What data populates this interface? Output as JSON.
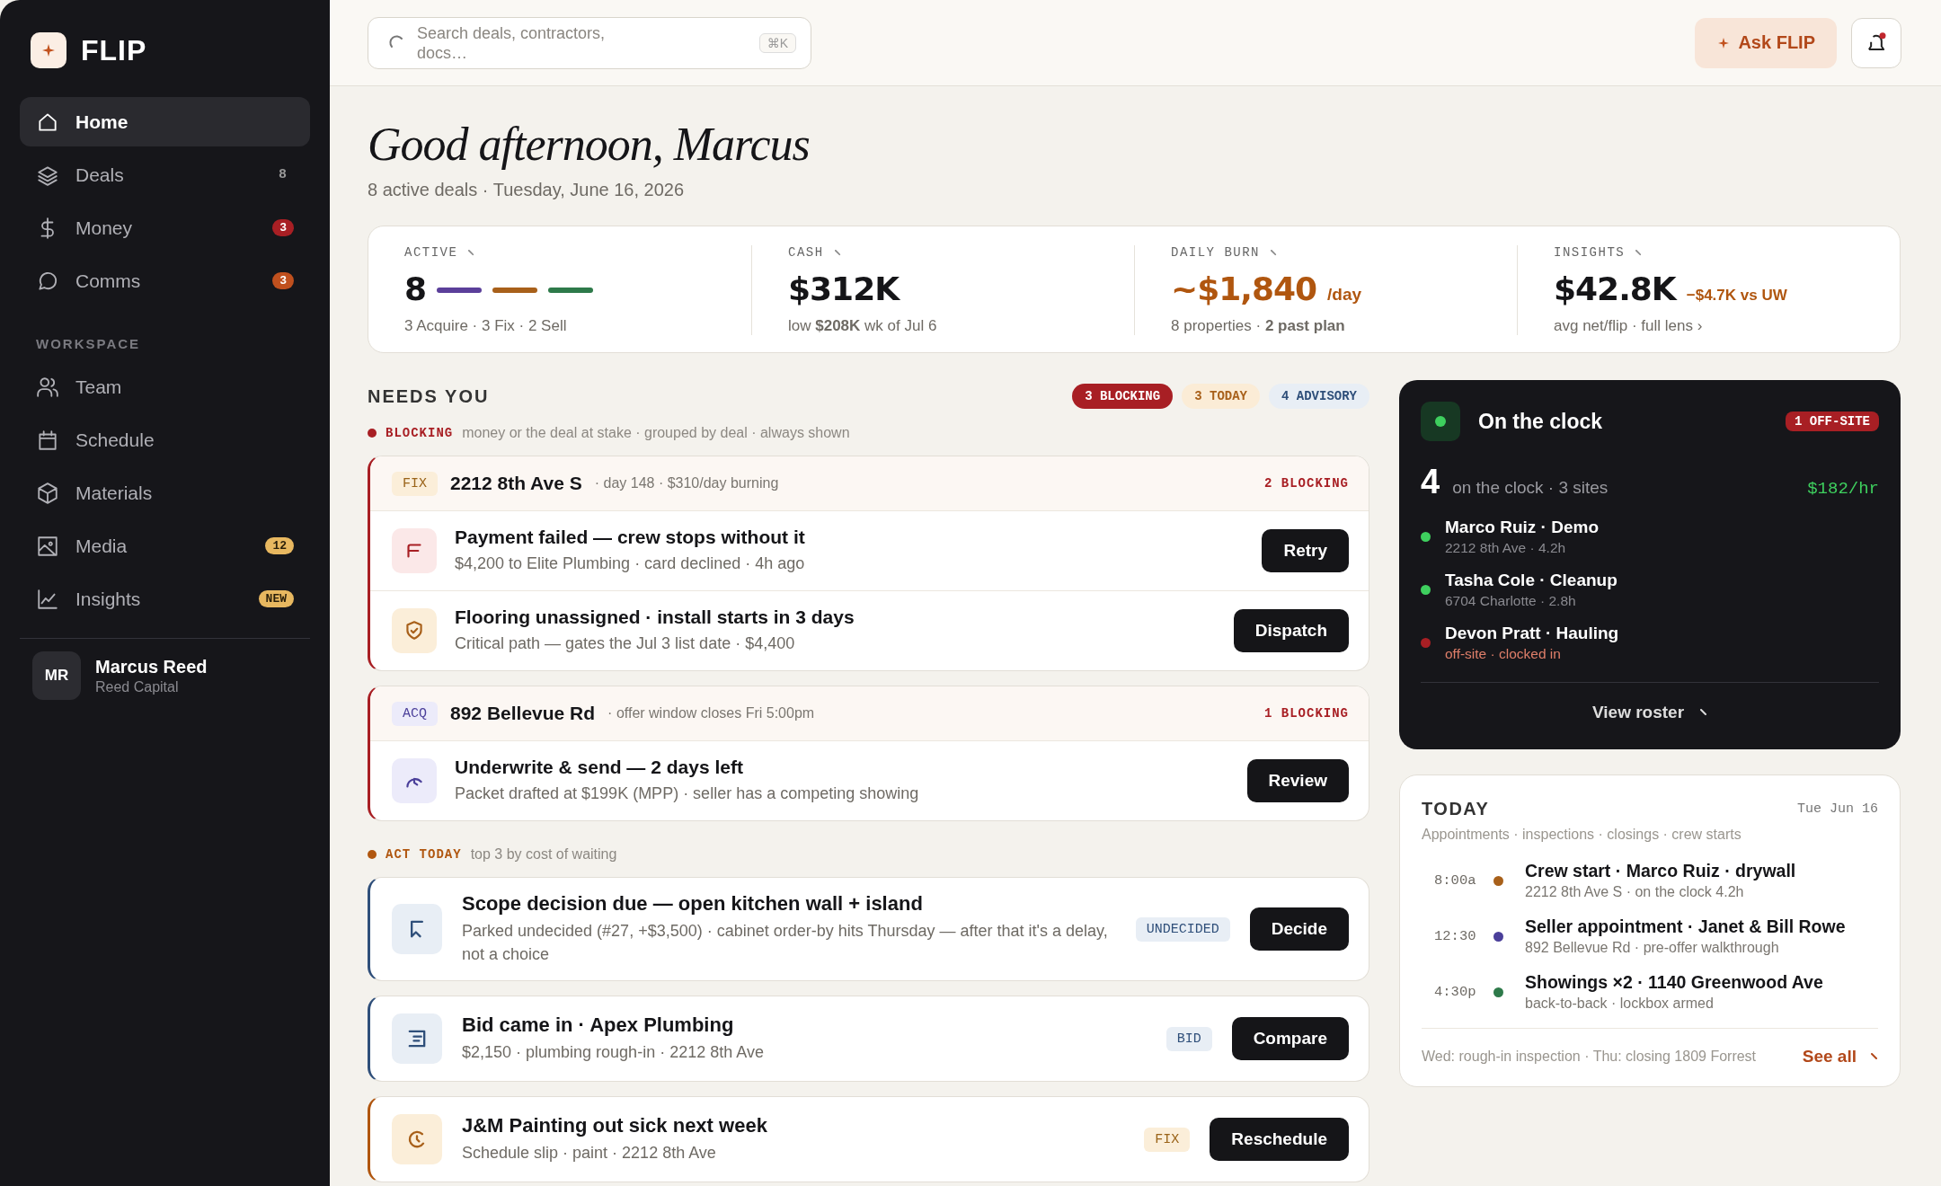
{
  "sidebar": {
    "brand": "FLIP",
    "nav": [
      {
        "label": "Home",
        "selected": true
      },
      {
        "label": "Deals",
        "selected": false,
        "badge": "8"
      },
      {
        "label": "Money",
        "selected": false,
        "badge": "3",
        "color": "#a81f24"
      },
      {
        "label": "Comms",
        "selected": false,
        "badge": "3",
        "color": "#c0501e"
      }
    ],
    "section_label": "WORKSPACE",
    "workspace": [
      {
        "label": "Team",
        "selected": false
      },
      {
        "label": "Schedule",
        "selected": false
      },
      {
        "label": "Materials",
        "selected": false
      },
      {
        "label": "Media",
        "selected": false,
        "badge": "12",
        "color": "#e8b860"
      },
      {
        "label": "Insights",
        "selected": false,
        "badge": "NEW",
        "color": "#e8b860"
      }
    ],
    "user": {
      "initials": "MR",
      "name": "Marcus Reed",
      "org": "Reed Capital"
    }
  },
  "topbar": {
    "search": {
      "placeholder": "Search deals, contractors, docs…",
      "shortcut": "⌘K"
    },
    "ask_button": "Ask FLIP",
    "notifications": {
      "unread": true
    }
  },
  "greeting": "Good afternoon, Marcus",
  "subline": "8 active deals · Tuesday, June 16, 2026",
  "stats": [
    {
      "kind": "mix",
      "label": "ACTIVE",
      "value": "8",
      "segments": [
        {
          "color": "#5b3f9a"
        },
        {
          "color": "#a8601a"
        },
        {
          "color": "#2e7a4a"
        }
      ],
      "sub": "3 Acquire · 3 Fix · 2 Sell"
    },
    {
      "kind": "cash",
      "label": "CASH",
      "value": "$312K",
      "sub": "low **$208K** wk of Jul 6"
    },
    {
      "kind": "burn",
      "label": "DAILY BURN",
      "value": "~$1,840",
      "unit": "/day",
      "sub": "8 properties · **2 past plan**"
    },
    {
      "kind": "insights",
      "label": "INSIGHTS",
      "value": "$42.8K",
      "delta": "−$4.7K vs UW",
      "sub": "avg net/flip · full lens ›"
    }
  ],
  "needs_you": {
    "title": "NEEDS YOU",
    "counts": [
      {
        "kind": "blocking",
        "label": "3 BLOCKING"
      },
      {
        "kind": "today",
        "label": "3 TODAY"
      },
      {
        "kind": "advisory",
        "label": "4 ADVISORY"
      }
    ],
    "blocking": {
      "label": "BLOCKING",
      "note": "money or the deal at stake · grouped by deal · always shown",
      "groups": [
        {
          "kind": "fix",
          "tag": "FIX",
          "address": "2212 8th Ave S",
          "meta": "· day 148 · $310/day burning",
          "count": "2 BLOCKING",
          "items": [
            {
              "kind": "payment",
              "title": "Payment failed — crew stops without it",
              "detail": "$4,200 to Elite Plumbing · card declined · 4h ago",
              "action": "Retry"
            },
            {
              "kind": "staffing",
              "title": "Flooring unassigned · install starts in 3 days",
              "detail": "Critical path — gates the Jul 3 list date · $4,400",
              "action": "Dispatch"
            }
          ]
        },
        {
          "kind": "acquire",
          "tag": "ACQ",
          "address": "892 Bellevue Rd",
          "meta": "· offer window closes Fri 5:00pm",
          "count": "1 BLOCKING",
          "items": [
            {
              "kind": "underwrite",
              "title": "Underwrite & send — 2 days left",
              "detail": "Packet drafted at $199K (MPP) · seller has a competing showing",
              "action": "Review"
            }
          ]
        }
      ]
    },
    "act_today": {
      "label": "ACT TODAY",
      "note": "top 3 by cost of waiting",
      "items": [
        {
          "kind": "decision",
          "title": "Scope decision due — open kitchen wall + island",
          "detail": "Parked undecided (#27, +$3,500) · cabinet order-by hits Thursday — after that it's a delay, not a choice",
          "tag": "UNDECIDED",
          "action": "Decide"
        },
        {
          "kind": "bid",
          "title": "Bid came in · Apex Plumbing",
          "detail": "$2,150 · plumbing rough-in · 2212 8th Ave",
          "tag": "BID",
          "action": "Compare"
        },
        {
          "kind": "schedule",
          "title": "J&M Painting out sick next week",
          "detail": "Schedule slip · paint · 2212 8th Ave",
          "tag": "FIX",
          "action": "Reschedule"
        }
      ]
    }
  },
  "clock": {
    "title": "On the clock",
    "badge": "1 OFF-SITE",
    "count": "4",
    "summary": "on the clock · 3 sites",
    "rate": "$182/hr",
    "crew": [
      {
        "name": "Marco Ruiz · Demo",
        "detail": "2212 8th Ave · 4.2h",
        "off_site": false
      },
      {
        "name": "Tasha Cole · Cleanup",
        "detail": "6704 Charlotte · 2.8h",
        "off_site": false
      },
      {
        "name": "Devon Pratt · Hauling",
        "detail": "off-site · clocked in",
        "off_site": true
      }
    ],
    "link": "View roster"
  },
  "today": {
    "title": "TODAY",
    "date": "Tue Jun 16",
    "subtitle": "Appointments · inspections · closings · crew starts",
    "events": [
      {
        "time": "8:00a",
        "color": "#a8601a",
        "title": "Crew start · Marco Ruiz · drywall",
        "detail": "2212 8th Ave S · on the clock 4.2h"
      },
      {
        "time": "12:30",
        "color": "#4b3f9a",
        "title": "Seller appointment · Janet & Bill Rowe",
        "detail": "892 Bellevue Rd · pre-offer walkthrough"
      },
      {
        "time": "4:30p",
        "color": "#2e7a4a",
        "title": "Showings ×2 · 1140 Greenwood Ave",
        "detail": "back-to-back · lockbox armed"
      }
    ],
    "footer": "Wed: rough-in inspection · Thu: closing 1809 Forrest",
    "link": "See all"
  }
}
